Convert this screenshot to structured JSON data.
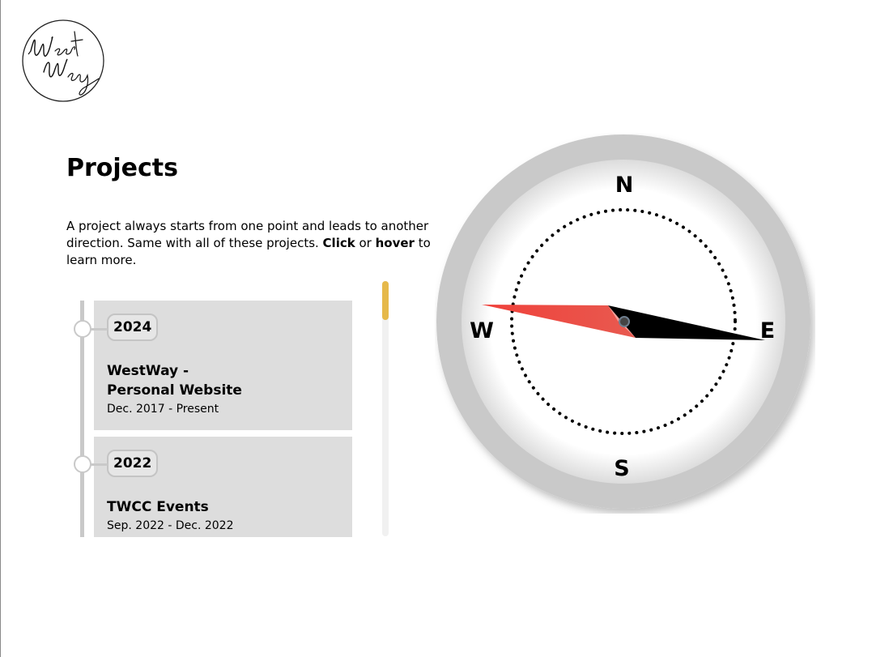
{
  "logo": {
    "icon": "westway-signature-logo",
    "text": "WestWay"
  },
  "header": {
    "title": "Projects"
  },
  "intro": {
    "part1": "A project always starts from one point and leads to another direction. Same with all of these projects. ",
    "click": "Click",
    "or": " or ",
    "hover": "hover",
    "part2": " to learn more."
  },
  "timeline": {
    "projects": [
      {
        "year": "2024",
        "title_line1": "WestWay -",
        "title_line2": "Personal Website",
        "date": "Dec. 2017 - Present"
      },
      {
        "year": "2022",
        "title_line1": "TWCC Events",
        "date": "Sep. 2022 - Dec. 2022"
      }
    ],
    "scroll_position": 0
  },
  "compass": {
    "labels": {
      "north": "N",
      "south": "S",
      "east": "E",
      "west": "W"
    },
    "needle_colors": {
      "west": "#f0403a",
      "east": "#000000"
    },
    "accent": "#e6b94a"
  }
}
